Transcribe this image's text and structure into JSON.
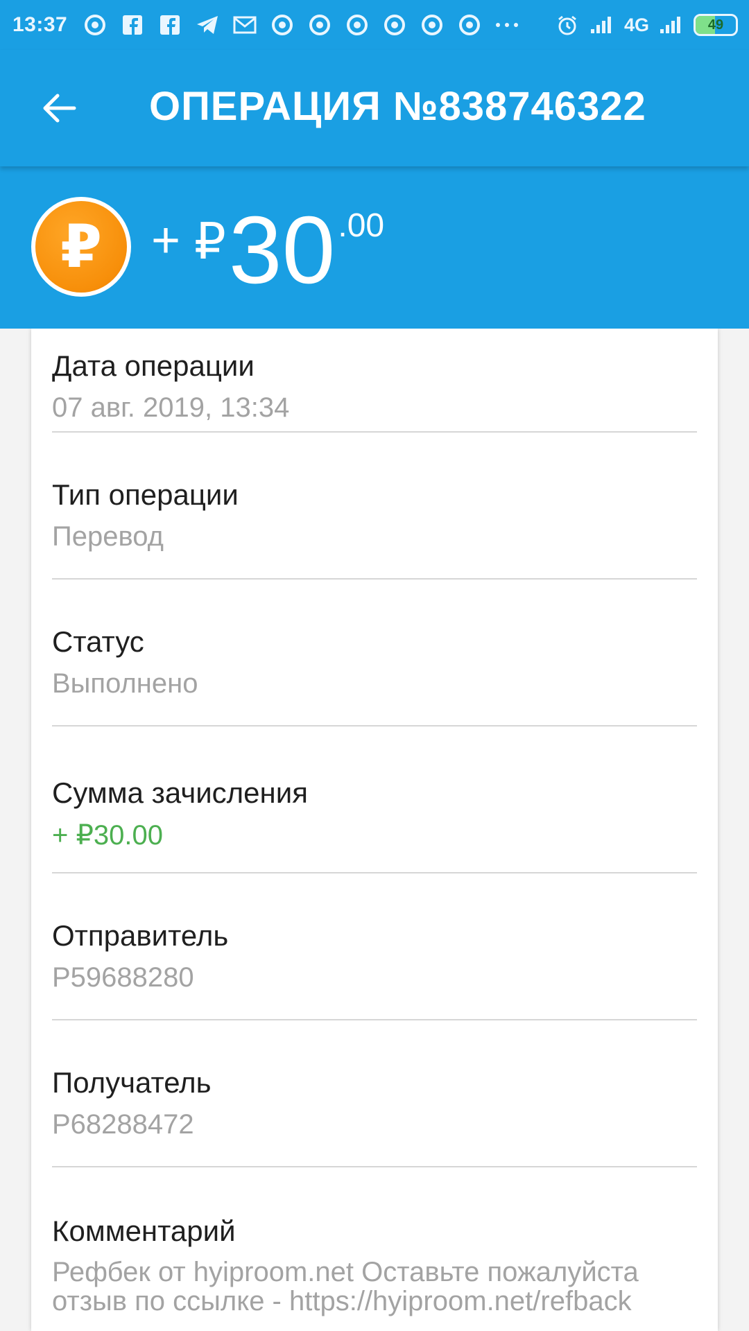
{
  "status_bar": {
    "time": "13:37",
    "network": "4G",
    "battery": "49",
    "icons": [
      "chrome-icon",
      "facebook-icon",
      "facebook-icon",
      "telegram-icon",
      "mail-icon",
      "chrome-icon",
      "chrome-icon",
      "chrome-icon",
      "chrome-icon",
      "chrome-icon",
      "chrome-icon",
      "more-dots-icon"
    ]
  },
  "app_bar": {
    "title": "ОПЕРАЦИЯ №838746322",
    "back_icon": "arrow-back-icon"
  },
  "amount": {
    "sign": "+",
    "currency": "₽",
    "integer": "30",
    "decimals": ".00",
    "coin_symbol": "₽"
  },
  "details": [
    {
      "label": "Дата операции",
      "value": "07 авг. 2019, 13:34"
    },
    {
      "label": "Тип операции",
      "value": "Перевод"
    },
    {
      "label": "Статус",
      "value": "Выполнено"
    },
    {
      "label": "Сумма зачисления",
      "value": "+ ₽30.00"
    },
    {
      "label": "Отправитель",
      "value": "P59688280"
    },
    {
      "label": "Получатель",
      "value": "P68288472"
    },
    {
      "label": "Комментарий",
      "value_line1": "Рефбек от hyiproom.net  Оставьте пожалуйста",
      "value_line2": "отзыв по ссылке - https://hyiproom.net/refback"
    }
  ],
  "colors": {
    "primary": "#1a9fe3",
    "credit_green": "#4caf50",
    "coin_orange": "#f78f0a"
  }
}
